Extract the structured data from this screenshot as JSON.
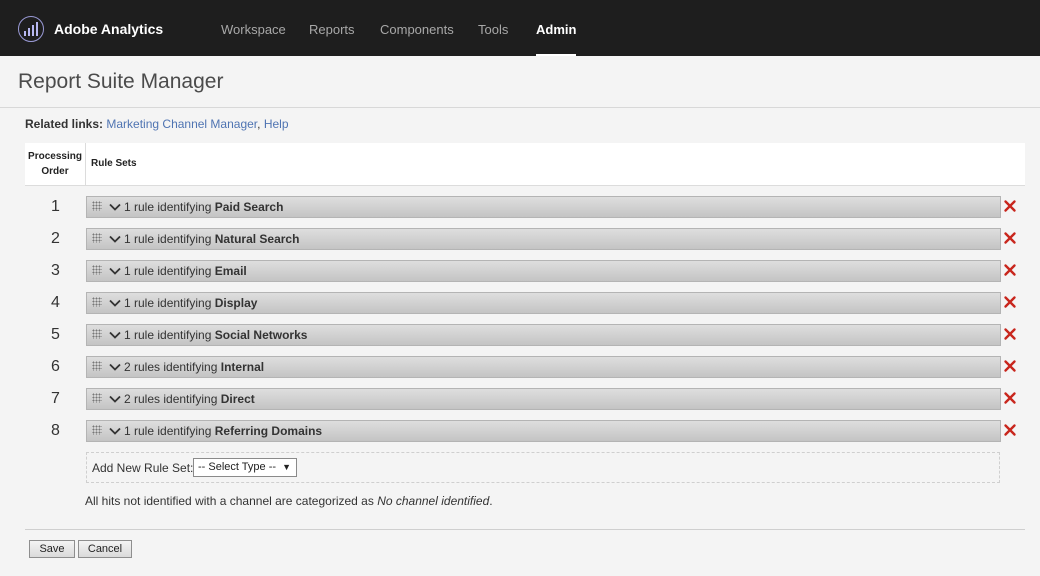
{
  "app": {
    "brand": "Adobe Analytics",
    "nav": [
      {
        "label": "Workspace",
        "active": false
      },
      {
        "label": "Reports",
        "active": false
      },
      {
        "label": "Components",
        "active": false
      },
      {
        "label": "Tools",
        "active": false
      },
      {
        "label": "Admin",
        "active": true
      }
    ]
  },
  "page": {
    "title": "Report Suite Manager",
    "related_label": "Related links:",
    "related_links": [
      "Marketing Channel Manager",
      "Help"
    ]
  },
  "table": {
    "headers": {
      "order_line1": "Processing",
      "order_line2": "Order",
      "rules": "Rule Sets"
    },
    "rows": [
      {
        "order": "1",
        "prefix": "1 rule identifying",
        "channel": "Paid Search"
      },
      {
        "order": "2",
        "prefix": "1 rule identifying",
        "channel": "Natural Search"
      },
      {
        "order": "3",
        "prefix": "1 rule identifying",
        "channel": "Email"
      },
      {
        "order": "4",
        "prefix": "1 rule identifying",
        "channel": "Display"
      },
      {
        "order": "5",
        "prefix": "1 rule identifying",
        "channel": "Social Networks"
      },
      {
        "order": "6",
        "prefix": "2 rules identifying",
        "channel": "Internal"
      },
      {
        "order": "7",
        "prefix": "2 rules identifying",
        "channel": "Direct"
      },
      {
        "order": "8",
        "prefix": "1 rule identifying",
        "channel": "Referring Domains"
      }
    ]
  },
  "add_rule": {
    "label": "Add New Rule Set:",
    "selected": "-- Select Type --"
  },
  "note": {
    "text": "All hits not identified with a channel are categorized as",
    "emphasis": "No channel identified",
    "end": "."
  },
  "buttons": {
    "save": "Save",
    "cancel": "Cancel"
  },
  "colors": {
    "topbar": "#1e1e1e",
    "link": "#4f74b2",
    "delete": "#c8261d"
  },
  "icons": {
    "logo": "analytics-logo-icon",
    "grip": "drag-handle-icon",
    "expand": "chevron-down-icon",
    "delete": "close-x-icon",
    "dropdown": "triangle-down-icon"
  }
}
